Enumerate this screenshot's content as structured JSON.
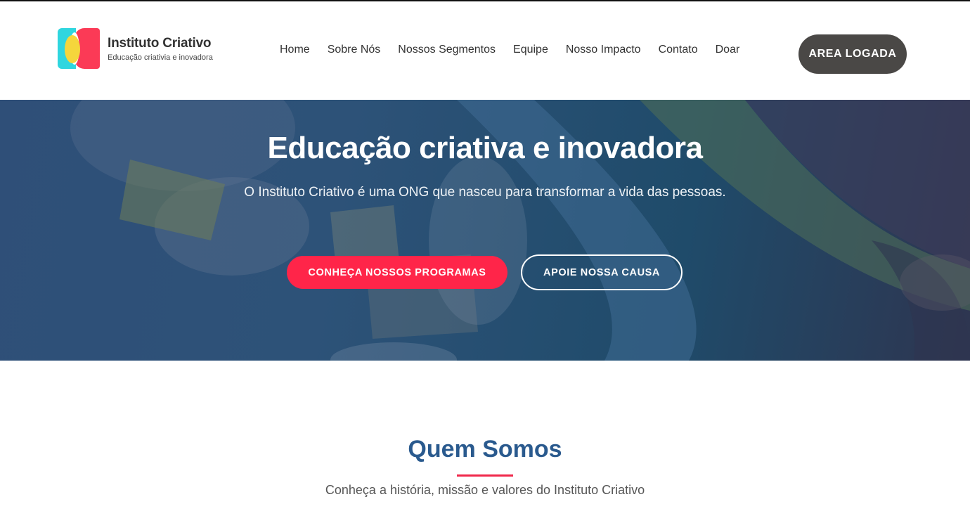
{
  "header": {
    "logo_title": "Instituto Criativo",
    "logo_subtitle": "Educação criativia e inovadora",
    "nav": [
      {
        "label": "Home"
      },
      {
        "label": "Sobre Nós"
      },
      {
        "label": "Nossos Segmentos"
      },
      {
        "label": "Equipe"
      },
      {
        "label": "Nosso Impacto"
      },
      {
        "label": "Contato"
      },
      {
        "label": "Doar"
      }
    ],
    "area_button": "AREA LOGADA"
  },
  "hero": {
    "title": "Educação criativa e inovadora",
    "text": "O Instituto Criativo é uma ONG que nasceu para transformar a vida das pessoas.",
    "primary_button": "CONHEÇA NOSSOS PROGRAMAS",
    "secondary_button": "APOIE NOSSA CAUSA"
  },
  "about": {
    "title": "Quem Somos",
    "subtitle": "Conheça a história, missão e valores do Instituto Criativo"
  },
  "colors": {
    "accent": "#ff2549",
    "heading_blue": "#2a5a8e",
    "dark_button": "#4a4846",
    "logo_cyan": "#2fd6df",
    "logo_yellow": "#f5d63c",
    "logo_red": "#fb3a56"
  }
}
